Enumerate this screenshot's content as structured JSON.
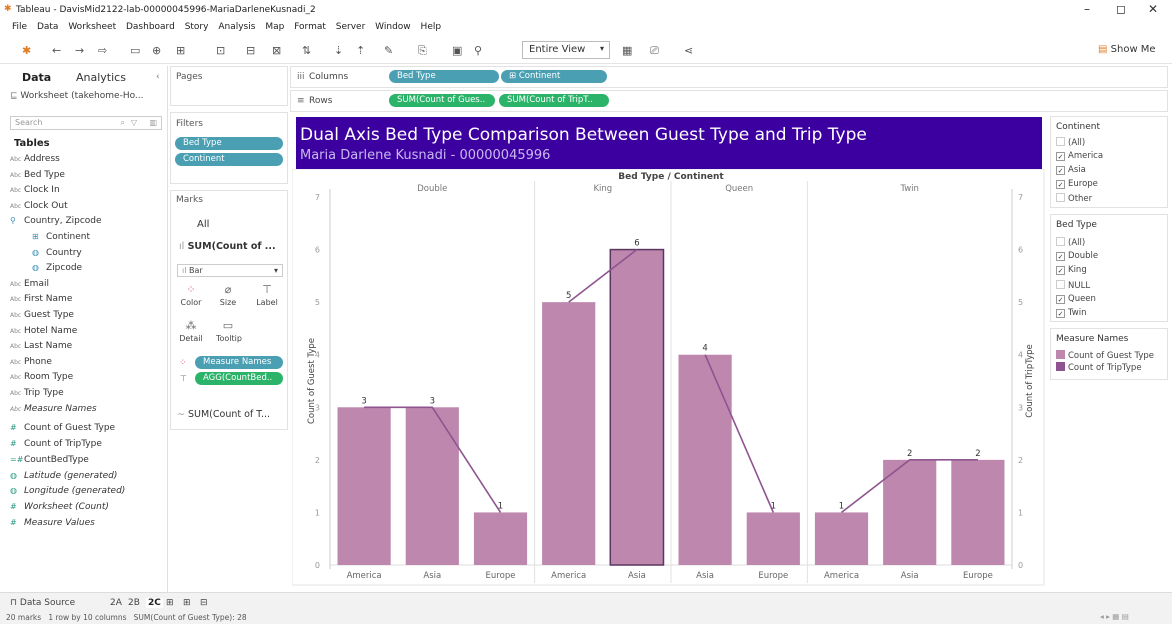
{
  "window": {
    "title": "Tableau - DavisMid2122-lab-00000045996-MariaDarleneKusnadi_2"
  },
  "menu": [
    "File",
    "Data",
    "Worksheet",
    "Dashboard",
    "Story",
    "Analysis",
    "Map",
    "Format",
    "Server",
    "Window",
    "Help"
  ],
  "toolbar": {
    "fit": "Entire View",
    "show_me": "Show Me"
  },
  "data_pane": {
    "tab_data": "Data",
    "tab_analytics": "Analytics",
    "source": "Worksheet (takehome-Ho...",
    "search_placeholder": "Search",
    "tables_heading": "Tables",
    "fields": [
      {
        "type": "Abc",
        "name": "Address"
      },
      {
        "type": "Abc",
        "name": "Bed Type"
      },
      {
        "type": "Abc",
        "name": "Clock In"
      },
      {
        "type": "Abc",
        "name": "Clock Out"
      },
      {
        "type": "geo",
        "name": "Country, Zipcode"
      },
      {
        "type": "hier",
        "name": "Continent"
      },
      {
        "type": "globe",
        "name": "Country"
      },
      {
        "type": "globe",
        "name": "Zipcode"
      },
      {
        "type": "Abc",
        "name": "Email"
      },
      {
        "type": "Abc",
        "name": "First Name"
      },
      {
        "type": "Abc",
        "name": "Guest Type"
      },
      {
        "type": "Abc",
        "name": "Hotel Name"
      },
      {
        "type": "Abc",
        "name": "Last Name"
      },
      {
        "type": "Abc",
        "name": "Phone"
      },
      {
        "type": "Abc",
        "name": "Room Type"
      },
      {
        "type": "Abc",
        "name": "Trip Type"
      },
      {
        "type": "Abc",
        "name": "Measure Names",
        "italic": true
      }
    ],
    "measures": [
      {
        "type": "#",
        "name": "Count of Guest Type"
      },
      {
        "type": "#",
        "name": "Count of TripType"
      },
      {
        "type": "=#",
        "name": "CountBedType"
      },
      {
        "type": "globe",
        "name": "Latitude (generated)",
        "italic": true
      },
      {
        "type": "globe",
        "name": "Longitude (generated)",
        "italic": true
      },
      {
        "type": "#",
        "name": "Worksheet (Count)",
        "italic": true
      },
      {
        "type": "#",
        "name": "Measure Values",
        "italic": true
      }
    ]
  },
  "shelves": {
    "pages": "Pages",
    "columns_label": "Columns",
    "rows_label": "Rows",
    "columns": [
      "Bed Type",
      "⊞ Continent"
    ],
    "rows": [
      "SUM(Count of Gues..",
      "SUM(Count of TripT.."
    ],
    "filters_label": "Filters",
    "filters": [
      "Bed Type",
      "Continent"
    ],
    "marks_label": "Marks",
    "marks_all": "All",
    "marks_sum": "SUM(Count of ...",
    "marks_type": "Bar",
    "marks_buttons": [
      "Color",
      "Size",
      "Label",
      "Detail",
      "Tooltip"
    ],
    "marks_pills": [
      "Measure Names",
      "AGG(CountBed.."
    ],
    "marks_sum2": "SUM(Count of T..."
  },
  "viz": {
    "title": "Dual Axis Bed Type Comparison Between Guest Type and Trip Type",
    "subtitle": "Maria Darlene Kusnadi - 00000045996"
  },
  "chart_data": {
    "type": "bar",
    "header": "Bed Type / Continent",
    "groups": [
      {
        "name": "Double",
        "categories": [
          "America",
          "Asia",
          "Europe"
        ]
      },
      {
        "name": "King",
        "categories": [
          "America",
          "Asia"
        ]
      },
      {
        "name": "Queen",
        "categories": [
          "Asia",
          "Europe"
        ]
      },
      {
        "name": "Twin",
        "categories": [
          "America",
          "Asia",
          "Europe"
        ]
      }
    ],
    "ylabel_left": "Count of Guest Type",
    "ylabel_right": "Count of TripType",
    "ylim": [
      0,
      7
    ],
    "yticks": [
      0,
      1,
      2,
      3,
      4,
      5,
      6,
      7
    ],
    "series": [
      {
        "name": "Count of Guest Type",
        "mark": "bar",
        "values": [
          3,
          3,
          1,
          5,
          6,
          4,
          1,
          1,
          2,
          2
        ]
      },
      {
        "name": "Count of TripType",
        "mark": "line",
        "values": [
          3,
          3,
          1,
          5,
          6,
          4,
          1,
          1,
          2,
          2
        ]
      }
    ],
    "data_labels": [
      3,
      3,
      1,
      5,
      6,
      4,
      1,
      1,
      2,
      2
    ],
    "bar_color": "#be88ae",
    "line_color": "#8e5490"
  },
  "legends": {
    "continent": {
      "title": "Continent",
      "items": [
        {
          "label": "(All)",
          "checked": false
        },
        {
          "label": "America",
          "checked": true
        },
        {
          "label": "Asia",
          "checked": true
        },
        {
          "label": "Europe",
          "checked": true
        },
        {
          "label": "Other",
          "checked": false
        }
      ]
    },
    "bed_type": {
      "title": "Bed Type",
      "items": [
        {
          "label": "(All)",
          "checked": false
        },
        {
          "label": "Double",
          "checked": true
        },
        {
          "label": "King",
          "checked": true
        },
        {
          "label": "NULL",
          "checked": false
        },
        {
          "label": "Queen",
          "checked": true
        },
        {
          "label": "Twin",
          "checked": true
        }
      ]
    },
    "measure_names": {
      "title": "Measure Names",
      "items": [
        {
          "label": "Count of Guest Type",
          "color": "#be88ae"
        },
        {
          "label": "Count of TripType",
          "color": "#8e5490"
        }
      ]
    }
  },
  "bottom": {
    "data_source": "Data Source",
    "tabs": [
      "2A",
      "2B",
      "2C"
    ],
    "status": "20 marks   1 row by 10 columns   SUM(Count of Guest Type): 28"
  }
}
